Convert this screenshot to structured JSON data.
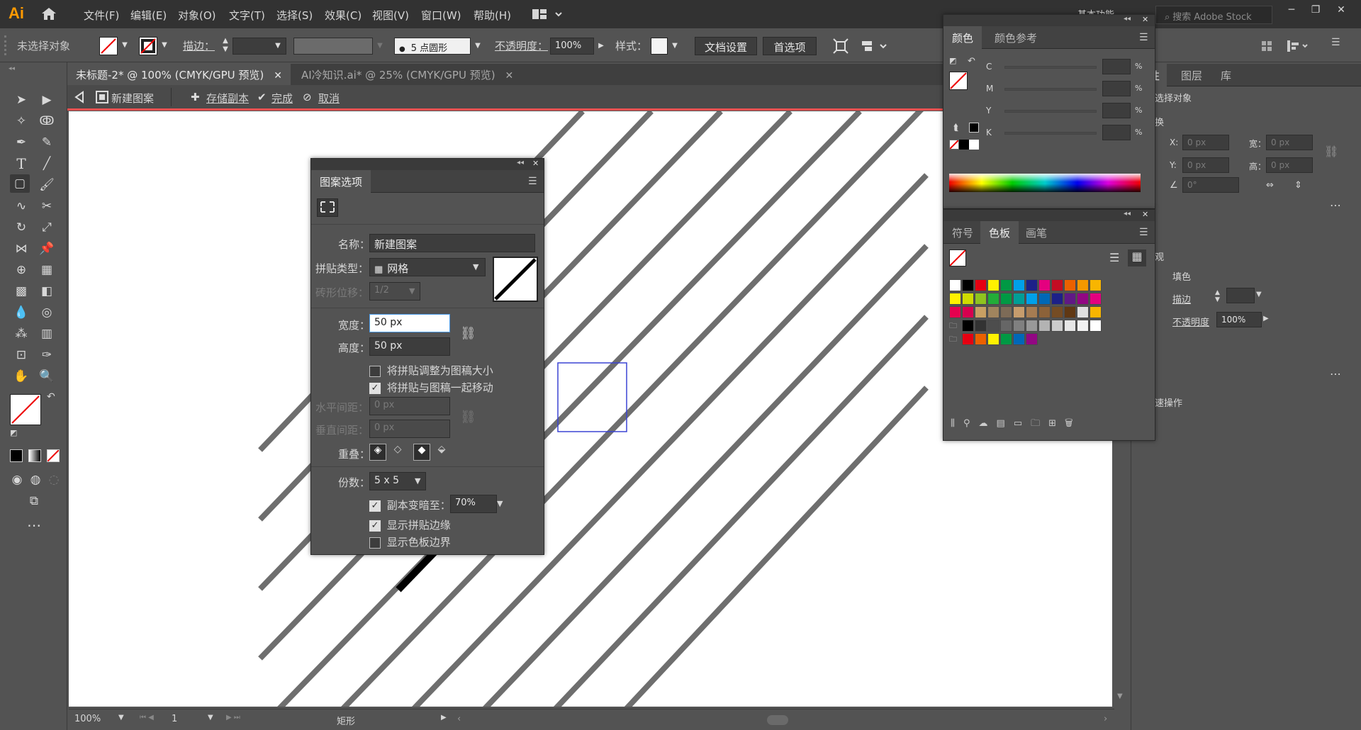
{
  "app": {
    "logo": "Ai",
    "workspace": "基本功能",
    "search_placeholder": "搜索 Adobe Stock"
  },
  "menu": [
    "文件(F)",
    "编辑(E)",
    "对象(O)",
    "文字(T)",
    "选择(S)",
    "效果(C)",
    "视图(V)",
    "窗口(W)",
    "帮助(H)"
  ],
  "control": {
    "selection": "未选择对象",
    "stroke_label": "描边：",
    "brush": "5 点圆形",
    "opacity_label": "不透明度：",
    "opacity": "100%",
    "style_label": "样式：",
    "doc_setup": "文档设置",
    "prefs": "首选项"
  },
  "tabs": [
    {
      "label": "未标题-2* @ 100% (CMYK/GPU 预览)"
    },
    {
      "label": "AI冷知识.ai* @ 25% (CMYK/GPU 预览)"
    }
  ],
  "isolation": {
    "name": "新建图案",
    "save_copy": "存储副本",
    "done": "完成",
    "cancel": "取消"
  },
  "pattern_options": {
    "title": "图案选项",
    "name_label": "名称：",
    "name": "新建图案",
    "tile_type_label": "拼贴类型：",
    "tile_type": "网格",
    "brick_offset_label": "砖形位移：",
    "brick_offset": "1/2",
    "width_label": "宽度：",
    "width": "50 px",
    "height_label": "高度：",
    "height": "50 px",
    "size_tile_to_art": "将拼贴调整为图稿大小",
    "move_tile_with_art": "将拼贴与图稿一起移动",
    "h_spacing_label": "水平间距：",
    "h_spacing": "0 px",
    "v_spacing_label": "垂直间距：",
    "v_spacing": "0 px",
    "overlap_label": "重叠：",
    "copies_label": "份数：",
    "copies": "5 x 5",
    "dim_copies": "副本变暗至：",
    "dim_value": "70%",
    "show_tile_edge": "显示拼贴边缘",
    "show_swatch_bounds": "显示色板边界"
  },
  "color_panel": {
    "tabs": [
      "颜色",
      "颜色参考"
    ],
    "channels": [
      "C",
      "M",
      "Y",
      "K"
    ],
    "unit": "%"
  },
  "swatch_panel": {
    "tabs": [
      "符号",
      "色板",
      "画笔"
    ],
    "rows": [
      [
        "#ffffff",
        "#000000",
        "#e60012",
        "#fff100",
        "#009944",
        "#00a0e9",
        "#1d2088",
        "#e4007f",
        "#c30d23",
        "#eb6100",
        "#f39800",
        "#f8b500"
      ],
      [
        "#fff100",
        "#cfdb00",
        "#8fc31f",
        "#22ac38",
        "#009944",
        "#009e96",
        "#00a0e9",
        "#0068b7",
        "#1d2088",
        "#601986",
        "#920783",
        "#e4007f"
      ],
      [
        "#e5004f",
        "#d7004f",
        "#c9a063",
        "#a0845e",
        "#7d6b57",
        "#c69c6d",
        "#a67c52",
        "#8c6239",
        "#754c24",
        "#603813",
        "#e0e0e0",
        "#f8b500"
      ],
      [
        "#000000",
        "#333333",
        "#4d4d4d",
        "#666666",
        "#808080",
        "#999999",
        "#b3b3b3",
        "#cccccc",
        "#e6e6e6",
        "#f2f2f2",
        "#ffffff"
      ],
      [
        "#e60012",
        "#eb6100",
        "#fff100",
        "#009944",
        "#0068b7",
        "#920783"
      ]
    ]
  },
  "right_panel": {
    "tabs": [
      "属性",
      "图层",
      "库"
    ],
    "no_selection": "未选择对象",
    "transform": "变换",
    "x_label": "X:",
    "y_label": "Y:",
    "w_label": "宽：",
    "h_label": "高：",
    "zero_px": "0 px",
    "angle": "0°",
    "appearance": "外观",
    "fill": "填色",
    "stroke": "描边",
    "opacity_label": "不透明度",
    "opacity": "100%",
    "quick_actions": "快速操作"
  },
  "status": {
    "zoom": "100%",
    "page": "1",
    "tool": "矩形"
  }
}
